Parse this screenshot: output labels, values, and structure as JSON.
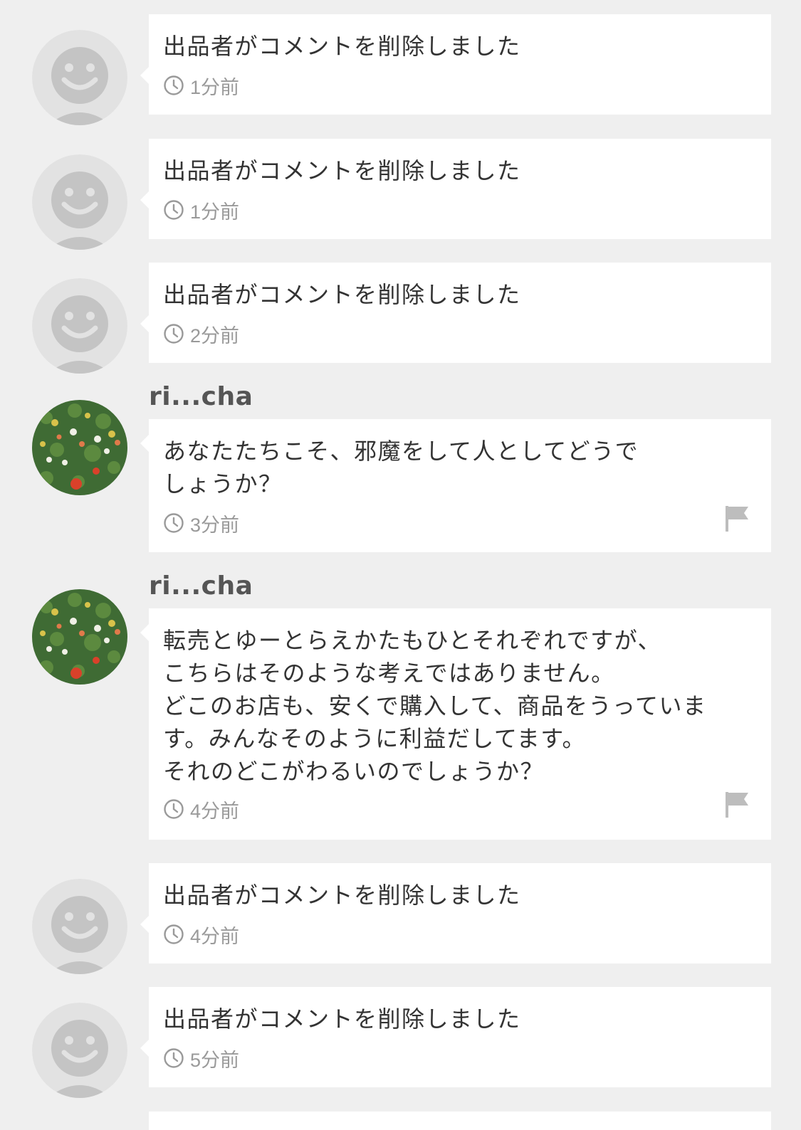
{
  "comments": [
    {
      "deleted": true,
      "text": "出品者がコメントを削除しました",
      "time": "1分前"
    },
    {
      "deleted": true,
      "text": "出品者がコメントを削除しました",
      "time": "1分前"
    },
    {
      "deleted": true,
      "text": "出品者がコメントを削除しました",
      "time": "2分前"
    },
    {
      "deleted": false,
      "username": "ri...cha",
      "text": "あなたたちこそ、邪魔をして人としてどうで\nしょうか？",
      "time": "3分前",
      "avatar_icon": "flower-field-avatar",
      "report_icon": "flag-icon"
    },
    {
      "deleted": false,
      "username": "ri...cha",
      "text": "転売とゆーとらえかたもひとそれぞれですが、\nこちらはそのような考えではありません。\nどこのお店も、安くで購入して、商品をうっていま\nす。みんなそのように利益だしてます。\nそれのどこがわるいのでしょうか？",
      "time": "4分前",
      "avatar_icon": "flower-field-avatar",
      "report_icon": "flag-icon"
    },
    {
      "deleted": true,
      "text": "出品者がコメントを削除しました",
      "time": "4分前"
    },
    {
      "deleted": true,
      "text": "出品者がコメントを削除しました",
      "time": "5分前"
    }
  ],
  "colors": {
    "background": "#efefef",
    "bubble": "#ffffff",
    "text": "#333333",
    "meta": "#9a9a9a",
    "username": "#555555",
    "placeholder_avatar": "#e2e2e2",
    "placeholder_face": "#c4c4c4"
  }
}
